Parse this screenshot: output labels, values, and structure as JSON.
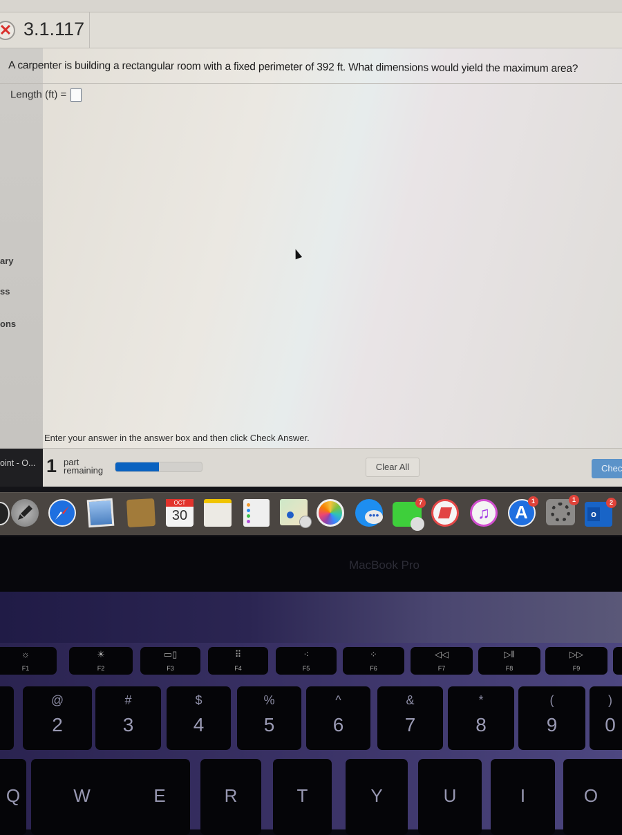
{
  "question": {
    "status_icon": "x-mark-icon",
    "id": "3.1.117",
    "text": "A carpenter is building a rectangular room with a fixed perimeter of 392 ft. What dimensions would yield the maximum area?",
    "fields": [
      {
        "label": "Length (ft) =",
        "value": ""
      }
    ],
    "instruction": "Enter your answer in the answer box and then click Check Answer."
  },
  "sidebar": {
    "items": [
      {
        "label": "ary"
      },
      {
        "label": "ss"
      },
      {
        "label": "ons"
      }
    ]
  },
  "footer": {
    "taskbar_label": "oint - O...",
    "parts_count": "1",
    "parts_label_line1": "part",
    "parts_label_line2": "remaining",
    "progress_fraction": 0.5,
    "clear_all_label": "Clear All",
    "check_answer_label": "Chec",
    "progress_color": "#0a62c0",
    "check_button_color": "#5b93c9"
  },
  "dock": {
    "apps": [
      {
        "name": "launchpad-icon"
      },
      {
        "name": "safari-icon"
      },
      {
        "name": "mail-icon"
      },
      {
        "name": "contacts-icon"
      },
      {
        "name": "calendar-icon",
        "month": "OCT",
        "day": "30"
      },
      {
        "name": "notes-icon"
      },
      {
        "name": "reminders-icon"
      },
      {
        "name": "maps-icon"
      },
      {
        "name": "photos-icon"
      },
      {
        "name": "messages-icon"
      },
      {
        "name": "facetime-icon",
        "badge": "7"
      },
      {
        "name": "news-icon"
      },
      {
        "name": "music-icon"
      },
      {
        "name": "app-store-icon",
        "badge": "1"
      },
      {
        "name": "system-preferences-icon",
        "badge": "1"
      },
      {
        "name": "outlook-icon",
        "badge": "2"
      }
    ]
  },
  "laptop": {
    "brand": "MacBook Pro"
  },
  "keyboard": {
    "function_row": [
      {
        "label": "F1",
        "glyph": "☼"
      },
      {
        "label": "F2",
        "glyph": "☀"
      },
      {
        "label": "F3",
        "glyph": "▭▯"
      },
      {
        "label": "F4",
        "glyph": "⠿"
      },
      {
        "label": "F5",
        "glyph": "⁖"
      },
      {
        "label": "F6",
        "glyph": "⁘"
      },
      {
        "label": "F7",
        "glyph": "◁◁"
      },
      {
        "label": "F8",
        "glyph": "▷ǁ"
      },
      {
        "label": "F9",
        "glyph": "▷▷"
      }
    ],
    "number_row": [
      {
        "sym": "@",
        "num": "2"
      },
      {
        "sym": "#",
        "num": "3"
      },
      {
        "sym": "$",
        "num": "4"
      },
      {
        "sym": "%",
        "num": "5"
      },
      {
        "sym": "^",
        "num": "6"
      },
      {
        "sym": "&",
        "num": "7"
      },
      {
        "sym": "*",
        "num": "8"
      },
      {
        "sym": "(",
        "num": "9"
      },
      {
        "sym": ")",
        "num": "0"
      }
    ],
    "letter_row": [
      "Q",
      "W",
      "E",
      "R",
      "T",
      "Y",
      "U",
      "I",
      "O"
    ]
  }
}
